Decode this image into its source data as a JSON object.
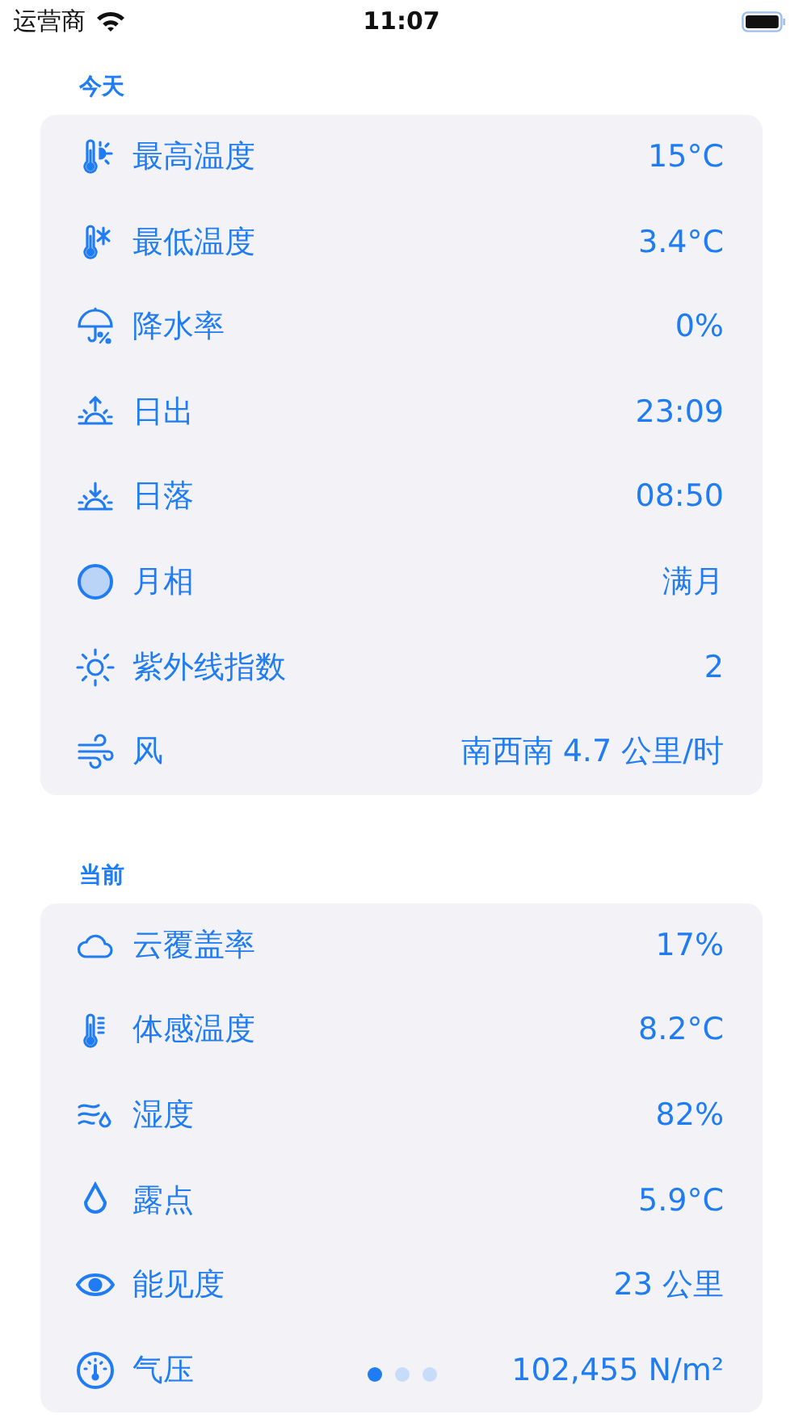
{
  "status_bar": {
    "carrier": "运营商",
    "time": "11:07"
  },
  "sections": [
    {
      "title": "今天",
      "rows": [
        {
          "label": "最高温度",
          "value": "15°C"
        },
        {
          "label": "最低温度",
          "value": "3.4°C"
        },
        {
          "label": "降水率",
          "value": "0%"
        },
        {
          "label": "日出",
          "value": "23:09"
        },
        {
          "label": "日落",
          "value": "08:50"
        },
        {
          "label": "月相",
          "value": "满月"
        },
        {
          "label": "紫外线指数",
          "value": "2"
        },
        {
          "label": "风",
          "value": "南西南 4.7 公里/时"
        }
      ]
    },
    {
      "title": "当前",
      "rows": [
        {
          "label": "云覆盖率",
          "value": "17%"
        },
        {
          "label": "体感温度",
          "value": "8.2°C"
        },
        {
          "label": "湿度",
          "value": "82%"
        },
        {
          "label": "露点",
          "value": "5.9°C"
        },
        {
          "label": "能见度",
          "value": "23 公里"
        },
        {
          "label": "气压",
          "value": "102,455 N/m²"
        }
      ]
    }
  ],
  "page_dots": [
    {
      "selected": true
    },
    {
      "selected": false
    },
    {
      "selected": false
    }
  ]
}
